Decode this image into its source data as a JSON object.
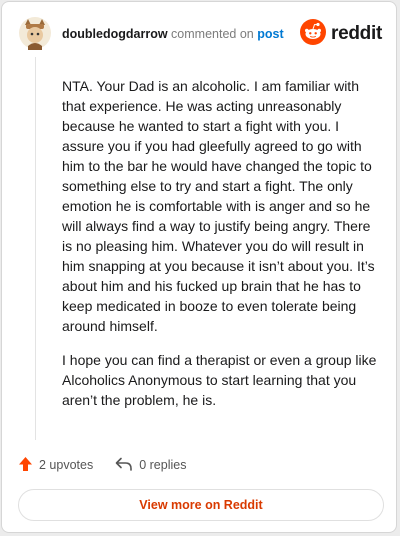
{
  "comment": {
    "username": "doubledogdarrow",
    "commented_on_text": "commented on",
    "post_link": "post",
    "paragraphs": [
      "NTA. Your Dad is an alcoholic. I am familiar with that experience. He was acting unreasonably because he wanted to start a fight with you. I assure you if you had gleefully agreed to go with him to the bar he would have changed the topic to something else to try and start a fight. The only emotion he is comfortable with is anger and so he will always find a way to justify being angry. There is no pleasing him. Whatever you do will result in him snapping at you because it isn’t about you. It’s about him and his fucked up brain that he has to keep medicated in booze to even tolerate being around himself.",
      "I hope you can find a therapist or even a group like Alcoholics Anonymous to start learning that you aren’t the problem, he is."
    ]
  },
  "brand": {
    "logo_text": "reddit",
    "accent_color": "#ff4500"
  },
  "actions": {
    "upvotes": "2 upvotes",
    "replies": "0 replies"
  },
  "footer": {
    "view_more": "View more on Reddit"
  },
  "icons": {
    "avatar": "avatar-icon",
    "logo": "reddit-logo-icon",
    "upvote": "upvote-arrow-icon",
    "reply": "reply-arrow-icon"
  }
}
